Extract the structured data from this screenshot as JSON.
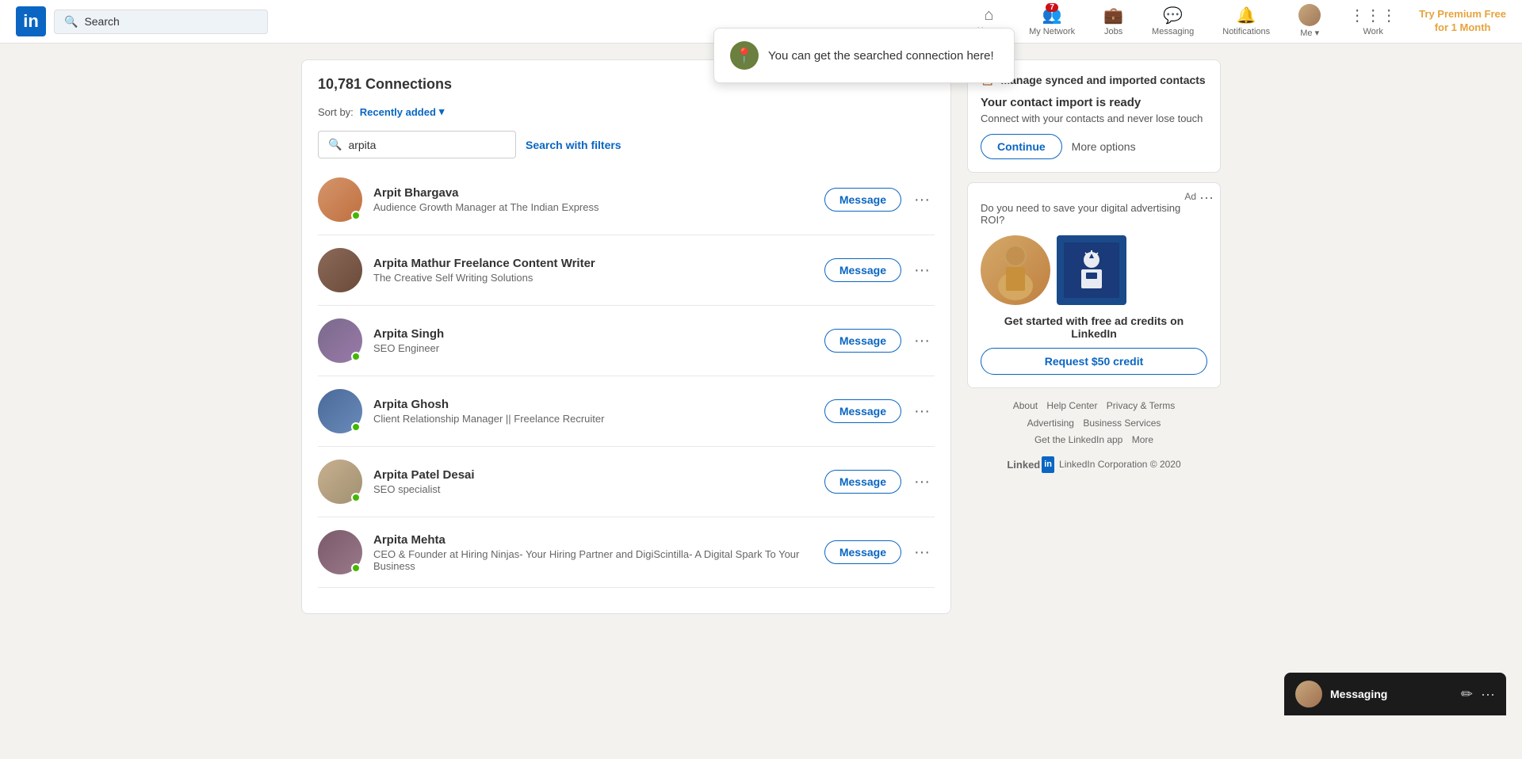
{
  "navbar": {
    "logo_text": "in",
    "search_placeholder": "Search",
    "search_value": "",
    "nav_items": [
      {
        "id": "home",
        "label": "Home",
        "icon": "⌂",
        "badge": null
      },
      {
        "id": "network",
        "label": "My Network",
        "icon": "👥",
        "badge": "7"
      },
      {
        "id": "jobs",
        "label": "Jobs",
        "icon": "💼",
        "badge": null
      },
      {
        "id": "messaging",
        "label": "Messaging",
        "icon": "💬",
        "badge": null
      },
      {
        "id": "notifications",
        "label": "Notifications",
        "icon": "🔔",
        "badge": null
      },
      {
        "id": "me",
        "label": "Me",
        "icon": "👤",
        "badge": null
      },
      {
        "id": "work",
        "label": "Work",
        "icon": "⋮⋮⋮",
        "badge": null
      }
    ],
    "premium_line1": "Try Premium Free",
    "premium_line2": "for 1 Month"
  },
  "tooltip": {
    "text": "You can get the searched connection here!",
    "pin_icon": "📍"
  },
  "connections": {
    "title": "10,781 Connections",
    "sort_label": "Sort by:",
    "sort_value": "Recently added",
    "search_value": "arpita",
    "search_with_filters": "Search with filters",
    "items": [
      {
        "name": "Arpit Bhargava",
        "title": "Audience Growth Manager at The Indian Express",
        "online": true,
        "av_class": "av1"
      },
      {
        "name": "Arpita Mathur Freelance Content Writer",
        "title": "The Creative Self Writing Solutions",
        "online": false,
        "av_class": "av2"
      },
      {
        "name": "Arpita Singh",
        "title": "SEO Engineer",
        "online": true,
        "av_class": "av3"
      },
      {
        "name": "Arpita Ghosh",
        "title": "Client Relationship Manager || Freelance Recruiter",
        "online": true,
        "av_class": "av4"
      },
      {
        "name": "Arpita Patel Desai",
        "title": "SEO specialist",
        "online": true,
        "av_class": "av5"
      },
      {
        "name": "Arpita Mehta",
        "title": "CEO & Founder at Hiring Ninjas- Your Hiring Partner and DigiScintilla- A Digital Spark To Your Business",
        "online": true,
        "av_class": "av6"
      }
    ],
    "message_btn": "Message"
  },
  "sidebar": {
    "import_icon": "📋",
    "import_header": "Manage synced and imported contacts",
    "import_title": "Your contact import is ready",
    "import_subtitle": "Connect with your contacts and never lose touch",
    "continue_label": "Continue",
    "more_options_label": "More options",
    "ad_label": "Ad",
    "ad_description": "Do you need to save your digital advertising ROI?",
    "ad_cta_text": "Get started with free ad credits on LinkedIn",
    "ad_cta_btn": "Request $50 credit"
  },
  "footer": {
    "links": [
      "About",
      "Help Center",
      "Privacy & Terms",
      "Advertising",
      "Business Services",
      "Get the LinkedIn app",
      "More"
    ],
    "copyright": "LinkedIn Corporation © 2020"
  },
  "messaging": {
    "label": "Messaging"
  }
}
